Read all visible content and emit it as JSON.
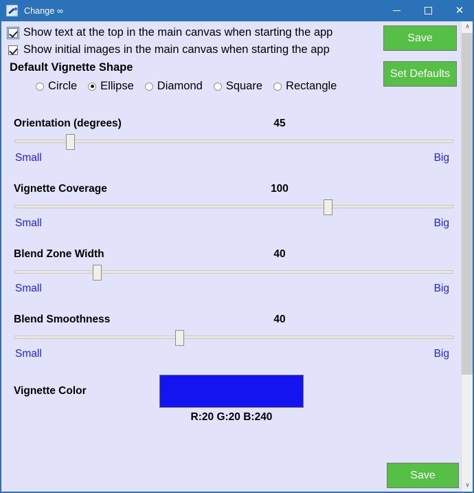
{
  "window": {
    "title": "Change ∞",
    "icon": "paintbrush-icon",
    "background_color": "#E2E2FA",
    "titlebar_color": "#2B72B8",
    "controls": {
      "minimize": "—",
      "maximize": "☐",
      "close": "✕"
    }
  },
  "checkboxes": [
    {
      "label": "Show text at the top in the main canvas when starting the app",
      "checked": true,
      "focused": true
    },
    {
      "label": "Show initial images in the main canvas when starting the app",
      "checked": true,
      "focused": false
    }
  ],
  "shape_group": {
    "heading": "Default Vignette Shape",
    "selected": "Ellipse",
    "options": [
      {
        "label": "Circle",
        "selected": false
      },
      {
        "label": "Ellipse",
        "selected": true
      },
      {
        "label": "Diamond",
        "selected": false
      },
      {
        "label": "Square",
        "selected": false
      },
      {
        "label": "Rectangle",
        "selected": false
      }
    ]
  },
  "buttons": {
    "save_top": "Save",
    "set_defaults": "Set Defaults",
    "save_bottom": "Save",
    "color": "#56C046"
  },
  "sliders": [
    {
      "title": "Orientation (degrees)",
      "value": "45",
      "percent": 12.7,
      "min_label": "Small",
      "max_label": "Big"
    },
    {
      "title": "Vignette Coverage",
      "value": "100",
      "percent": 71.4,
      "min_label": "Small",
      "max_label": "Big"
    },
    {
      "title": "Blend Zone Width",
      "value": "40",
      "percent": 18.9,
      "min_label": "Small",
      "max_label": "Big"
    },
    {
      "title": "Blend Smoothness",
      "value": "40",
      "percent": 37.7,
      "min_label": "Small",
      "max_label": "Big"
    }
  ],
  "vignette_color": {
    "label": "Vignette Color",
    "swatch_hex": "#1414F0",
    "rgb_text": "R:20 G:20 B:240"
  },
  "scrollbar": {
    "up_arrow": "∧",
    "down_arrow": "∨"
  }
}
